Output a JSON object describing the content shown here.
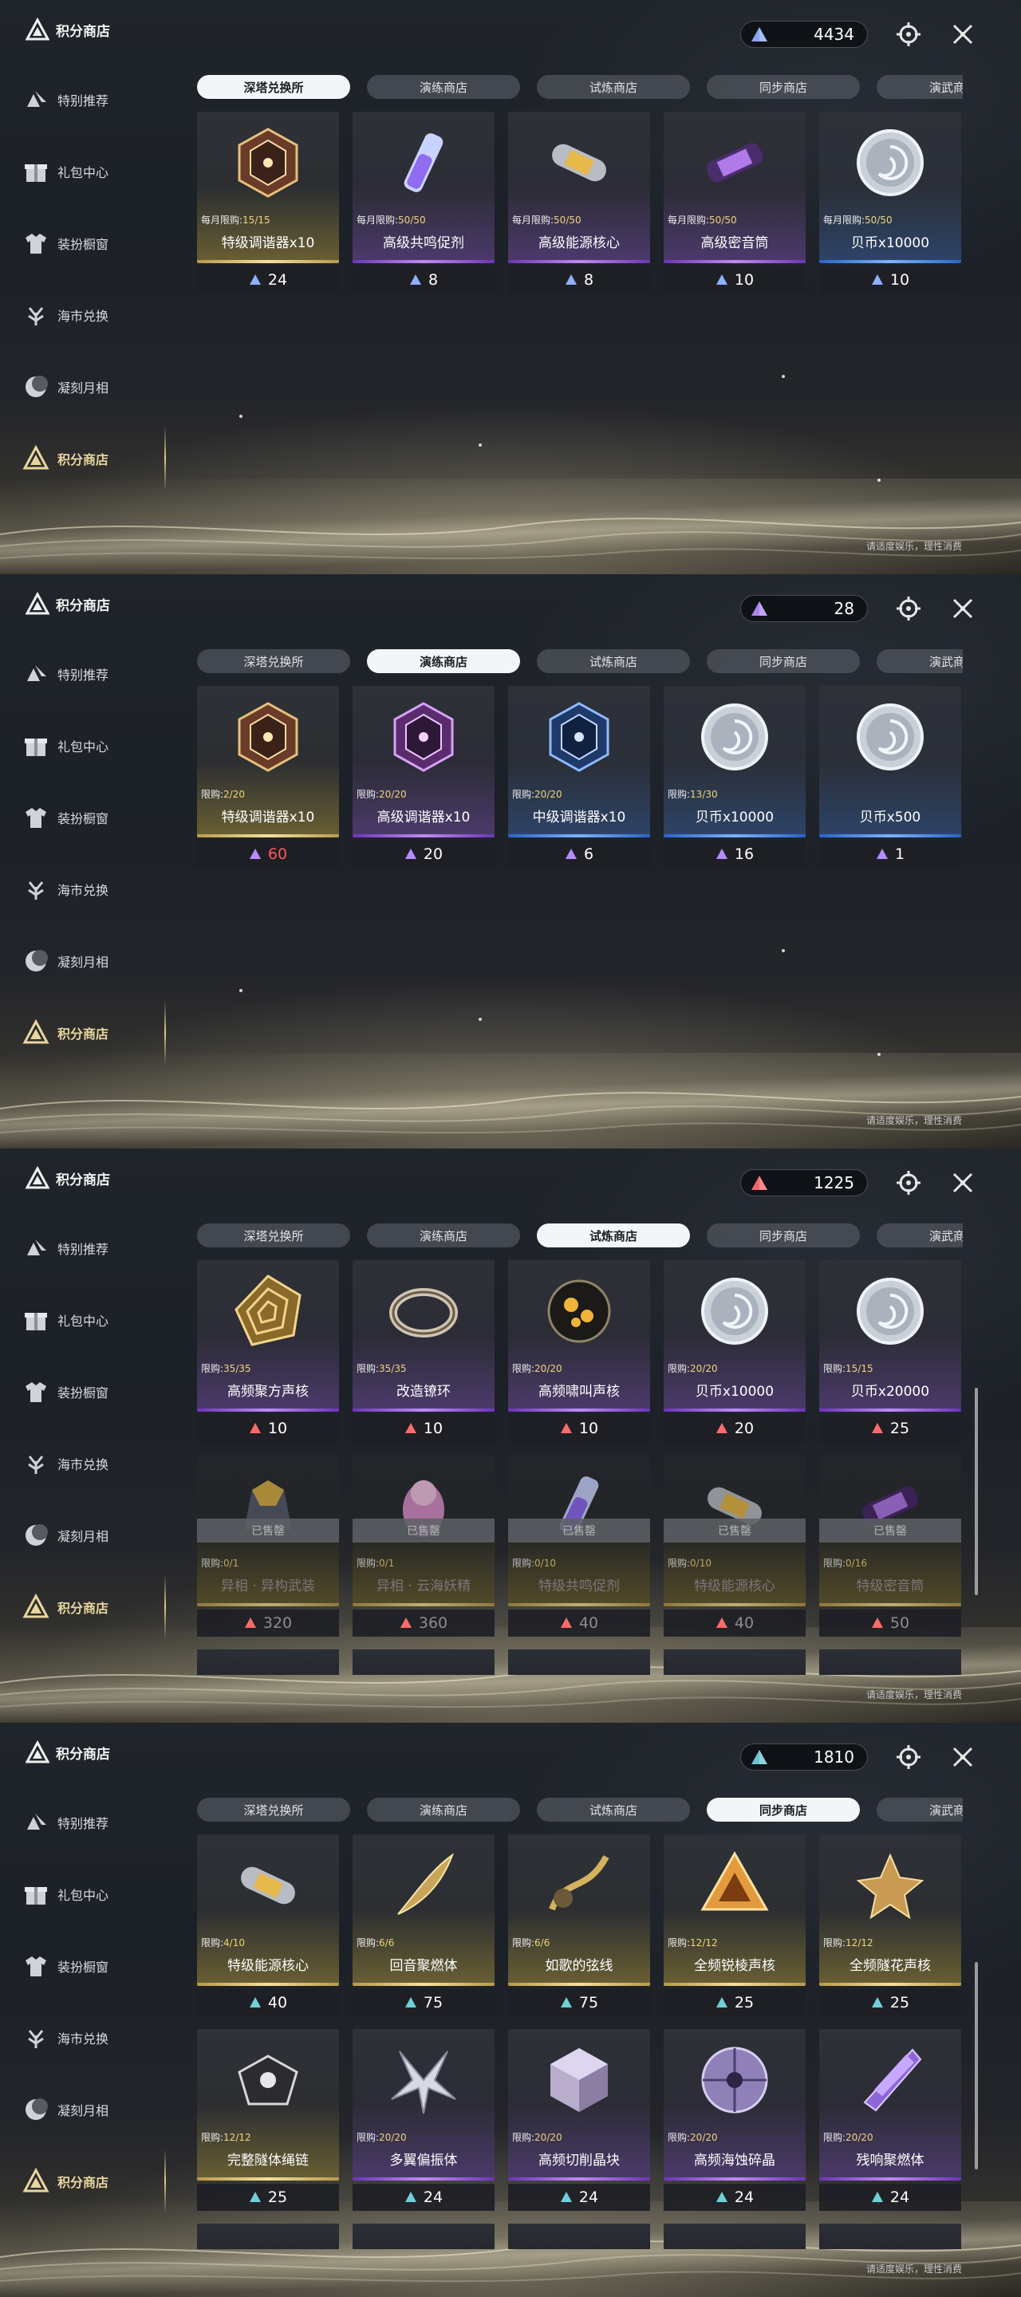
{
  "common": {
    "app_title": "积分商店",
    "note": "请适度娱乐，理性消费",
    "sidebar": [
      "特别推荐",
      "礼包中心",
      "装扮橱窗",
      "海市兑换",
      "凝刻月相",
      "积分商店"
    ],
    "tabs": [
      "深塔兑换所",
      "演练商店",
      "试炼商店",
      "同步商店",
      "演武商店"
    ],
    "icons": [
      "sidebar-star-icon",
      "gift-icon",
      "shirt-icon",
      "tree-icon",
      "moon-icon",
      "triangle-emblem-icon"
    ],
    "colors": {
      "gold": "#f0d57a",
      "purple": "#c08af2",
      "blue": "#7ab3ff",
      "red_price": "#ff5a5a"
    }
  },
  "panels": [
    {
      "active_tab": 0,
      "currency": {
        "amount": "4434",
        "color": "#8fb0ff",
        "icon": "blue-triangle-icon"
      },
      "items": [
        {
          "name": "特级调谐器x10",
          "limit_label": "每月限购:",
          "limit_value": "15/15",
          "price": "24",
          "rarity": "gold",
          "icon": "gold-tuner-icon"
        },
        {
          "name": "高级共鸣促剂",
          "limit_label": "每月限购:",
          "limit_value": "50/50",
          "price": "8",
          "rarity": "purple",
          "icon": "vial-icon"
        },
        {
          "name": "高级能源核心",
          "limit_label": "每月限购:",
          "limit_value": "50/50",
          "price": "8",
          "rarity": "purple",
          "icon": "capsule-icon"
        },
        {
          "name": "高级密音筒",
          "limit_label": "每月限购:",
          "limit_value": "50/50",
          "price": "10",
          "rarity": "purple",
          "icon": "canister-icon"
        },
        {
          "name": "贝币x10000",
          "limit_label": "每月限购:",
          "limit_value": "50/50",
          "price": "10",
          "rarity": "blue",
          "icon": "coin-icon"
        }
      ],
      "row2": [],
      "stubs": false,
      "scrollbar": false
    },
    {
      "active_tab": 1,
      "currency": {
        "amount": "28",
        "color": "#b58cff",
        "icon": "purple-triangle-icon"
      },
      "items": [
        {
          "name": "特级调谐器x10",
          "limit_label": "限购:",
          "limit_value": "2/20",
          "price": "60",
          "rarity": "gold",
          "icon": "gold-tuner-icon",
          "price_red": true
        },
        {
          "name": "高级调谐器x10",
          "limit_label": "限购:",
          "limit_value": "20/20",
          "price": "20",
          "rarity": "purple",
          "icon": "purple-tuner-icon"
        },
        {
          "name": "中级调谐器x10",
          "limit_label": "限购:",
          "limit_value": "20/20",
          "price": "6",
          "rarity": "blue",
          "icon": "blue-tuner-icon"
        },
        {
          "name": "贝币x10000",
          "limit_label": "限购:",
          "limit_value": "13/30",
          "price": "16",
          "rarity": "blue",
          "icon": "coin-icon"
        },
        {
          "name": "贝币x500",
          "limit_label": "",
          "limit_value": "",
          "price": "1",
          "rarity": "blue",
          "icon": "coin-icon"
        }
      ],
      "row2": [],
      "stubs": false,
      "scrollbar": false
    },
    {
      "active_tab": 2,
      "currency": {
        "amount": "1225",
        "color": "#ff6b6b",
        "icon": "red-triangle-icon"
      },
      "items": [
        {
          "name": "高频聚方声核",
          "limit_label": "限购:",
          "limit_value": "35/35",
          "price": "10",
          "rarity": "purple",
          "icon": "gold-spiral-icon"
        },
        {
          "name": "改造镣环",
          "limit_label": "限购:",
          "limit_value": "35/35",
          "price": "10",
          "rarity": "purple",
          "icon": "ring-icon"
        },
        {
          "name": "高频啸叫声核",
          "limit_label": "限购:",
          "limit_value": "20/20",
          "price": "10",
          "rarity": "purple",
          "icon": "orb-icon"
        },
        {
          "name": "贝币x10000",
          "limit_label": "限购:",
          "limit_value": "20/20",
          "price": "20",
          "rarity": "purple",
          "icon": "coin-icon"
        },
        {
          "name": "贝币x20000",
          "limit_label": "限购:",
          "limit_value": "15/15",
          "price": "25",
          "rarity": "purple",
          "icon": "coin-icon"
        }
      ],
      "row2": [
        {
          "name": "异相 · 异构武装",
          "limit_label": "限购:",
          "limit_value": "0/1",
          "price": "320",
          "sold": "已售罄",
          "icon": "armor-icon"
        },
        {
          "name": "异相 · 云海妖精",
          "limit_label": "限购:",
          "limit_value": "0/1",
          "price": "360",
          "sold": "已售罄",
          "icon": "fairy-icon"
        },
        {
          "name": "特级共鸣促剂",
          "limit_label": "限购:",
          "limit_value": "0/10",
          "price": "40",
          "sold": "已售罄",
          "icon": "vial-icon"
        },
        {
          "name": "特级能源核心",
          "limit_label": "限购:",
          "limit_value": "0/10",
          "price": "40",
          "sold": "已售罄",
          "icon": "capsule-icon"
        },
        {
          "name": "特级密音筒",
          "limit_label": "限购:",
          "limit_value": "0/16",
          "price": "50",
          "sold": "已售罄",
          "icon": "canister-icon"
        }
      ],
      "stubs": true,
      "scrollbar": true
    },
    {
      "active_tab": 3,
      "currency": {
        "amount": "1810",
        "color": "#6fd0d8",
        "icon": "teal-triangle-icon"
      },
      "items": [
        {
          "name": "特级能源核心",
          "limit_label": "限购:",
          "limit_value": "4/10",
          "price": "40",
          "rarity": "gold",
          "icon": "capsule-icon"
        },
        {
          "name": "回音聚燃体",
          "limit_label": "限购:",
          "limit_value": "6/6",
          "price": "75",
          "rarity": "gold",
          "icon": "feather-icon"
        },
        {
          "name": "如歌的弦线",
          "limit_label": "限购:",
          "limit_value": "6/6",
          "price": "75",
          "rarity": "gold",
          "icon": "string-icon"
        },
        {
          "name": "全频锐棱声核",
          "limit_label": "限购:",
          "limit_value": "12/12",
          "price": "25",
          "rarity": "gold",
          "icon": "prism-icon"
        },
        {
          "name": "全频隧花声核",
          "limit_label": "限购:",
          "limit_value": "12/12",
          "price": "25",
          "rarity": "gold",
          "icon": "flower-core-icon"
        }
      ],
      "row2": [
        {
          "name": "完整隧体绳链",
          "limit_label": "限购:",
          "limit_value": "12/12",
          "price": "25",
          "rarity": "gold",
          "icon": "chain-icon"
        },
        {
          "name": "多翼偏振体",
          "limit_label": "限购:",
          "limit_value": "20/20",
          "price": "24",
          "rarity": "purple",
          "icon": "wing-icon"
        },
        {
          "name": "高频切削晶块",
          "limit_label": "限购:",
          "limit_value": "20/20",
          "price": "24",
          "rarity": "purple",
          "icon": "cube-icon"
        },
        {
          "name": "高频海蚀碎晶",
          "limit_label": "限购:",
          "limit_value": "20/20",
          "price": "24",
          "rarity": "purple",
          "icon": "disc-icon"
        },
        {
          "name": "残响聚燃体",
          "limit_label": "限购:",
          "limit_value": "20/20",
          "price": "24",
          "rarity": "purple",
          "icon": "shard-icon"
        }
      ],
      "stubs": true,
      "scrollbar": true
    }
  ]
}
